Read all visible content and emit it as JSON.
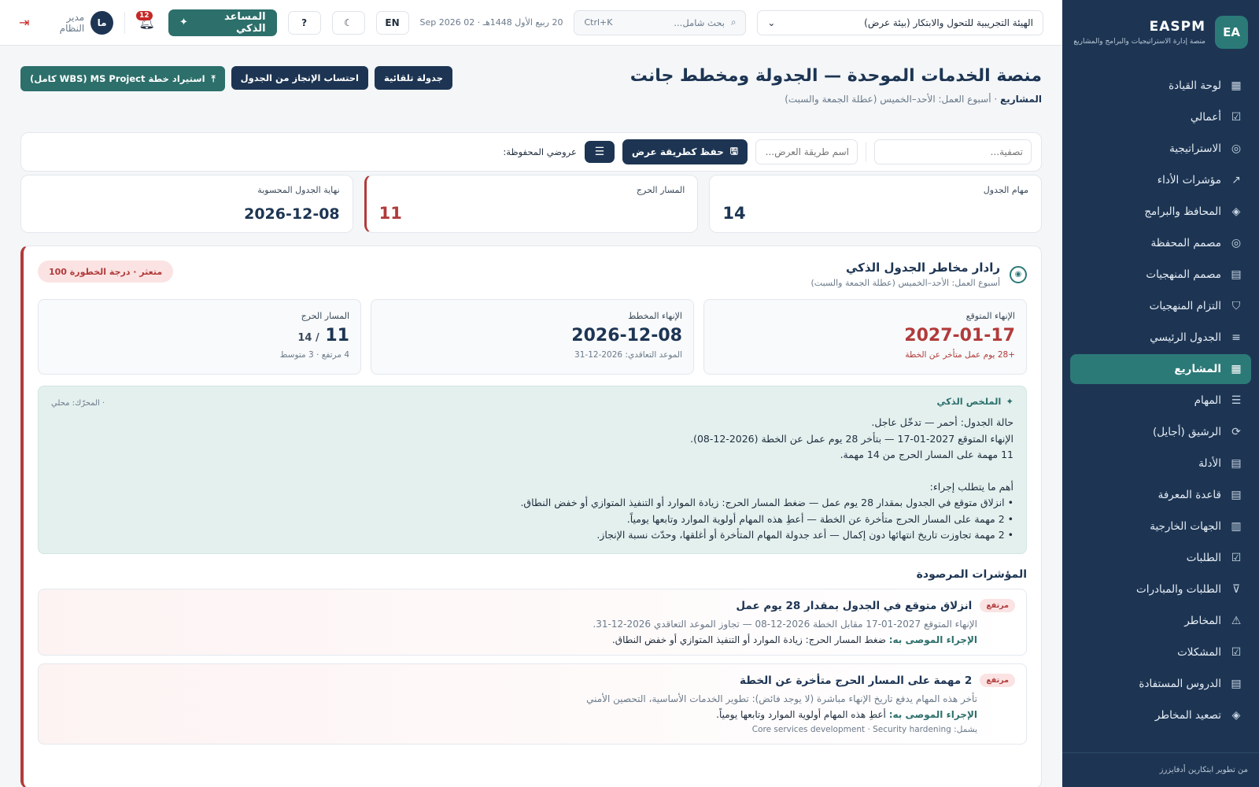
{
  "sidebar": {
    "brand_badge": "EA",
    "brand_title": "EASPM",
    "brand_sub": "منصة إدارة الاستراتيجيات والبرامج والمشاريع",
    "items": [
      {
        "label": "لوحة القيادة",
        "icon": "▦"
      },
      {
        "label": "أعمالي",
        "icon": "☑"
      },
      {
        "label": "الاستراتيجية",
        "icon": "◎"
      },
      {
        "label": "مؤشرات الأداء",
        "icon": "↗"
      },
      {
        "label": "المحافظ والبرامج",
        "icon": "◈"
      },
      {
        "label": "مصمم المحفظة",
        "icon": "◎"
      },
      {
        "label": "مصمم المنهجيات",
        "icon": "▤"
      },
      {
        "label": "التزام المنهجيات",
        "icon": "⛉"
      },
      {
        "label": "الجدول الرئيسي",
        "icon": "≡"
      },
      {
        "label": "المشاريع",
        "icon": "▦"
      },
      {
        "label": "المهام",
        "icon": "☰"
      },
      {
        "label": "الرشيق (أجايل)",
        "icon": "⟳"
      },
      {
        "label": "الأدلة",
        "icon": "▤"
      },
      {
        "label": "قاعدة المعرفة",
        "icon": "▤"
      },
      {
        "label": "الجهات الخارجية",
        "icon": "▥"
      },
      {
        "label": "الطلبات",
        "icon": "☑"
      },
      {
        "label": "الطلبات والمبادرات",
        "icon": "⊽"
      },
      {
        "label": "المخاطر",
        "icon": "⚠"
      },
      {
        "label": "المشكلات",
        "icon": "☑"
      },
      {
        "label": "الدروس المستفادة",
        "icon": "▤"
      },
      {
        "label": "تصعيد المخاطر",
        "icon": "◈"
      }
    ],
    "footer": "من تطوير ابتكارين أدفايزرز"
  },
  "topbar": {
    "org": "الهيئة التجريبية للتحول والابتكار (بيئة عرض)",
    "search_placeholder": "بحث شامل...",
    "search_shortcut": "Ctrl+K",
    "date": "20 ربيع الأول 1448هـ  ·  02 Sep 2026",
    "lang": "EN",
    "ai_label": "المساعد الذكي",
    "notifications": "12",
    "avatar": "ما",
    "user_name": "مدير النظام"
  },
  "page": {
    "title": "منصة الخدمات الموحدة — الجدولة ومخطط جانت",
    "breadcrumb": "المشاريع",
    "workweek": "أسبوع العمل: الأحد–الخميس (عطلة الجمعة والسبت)",
    "btn_auto": "جدولة تلقائية",
    "btn_calc": "احتساب الإنجاز من الجدول",
    "btn_import": "استيراد خطة MS Project (WBS كامل)"
  },
  "views": {
    "filter_placeholder": "تصفية...",
    "name_placeholder": "اسم طريقة العرض...",
    "save_label": "حفظ كطريقة عرض",
    "saved_label": "عروضي المحفوظة:"
  },
  "stats": {
    "tasks_label": "مهام الجدول",
    "tasks_value": "14",
    "critical_label": "المسار الحرج",
    "critical_value": "11",
    "end_label": "نهاية الجدول المحسوبة",
    "end_value": "2026-12-08"
  },
  "radar": {
    "title": "رادار مخاطر الجدول الذكي",
    "sub": "أسبوع العمل: الأحد–الخميس (عطلة الجمعة والسبت)",
    "risk": "متعثر · درجة الخطورة 100",
    "expected_label": "الإنهاء المتوقع",
    "expected_value": "2027-01-17",
    "expected_note": "+28 يوم عمل متأخر عن الخطة",
    "planned_label": "الإنهاء المخطط",
    "planned_value": "2026-12-08",
    "planned_note": "الموعد التعاقدي: 2026-12-31",
    "critical_label": "المسار الحرج",
    "critical_value": "11",
    "critical_total": "/ 14",
    "critical_note": "4 مرتفع · 3 متوسط",
    "summary_title": "الملخص الذكي",
    "summary_engine": "· المحرّك: محلي",
    "summary_lines": [
      "حالة الجدول: أحمر — تدخّل عاجل.",
      "الإنهاء المتوقع 2027-01-17 — بتأخر 28 يوم عمل عن الخطة (2026-12-08).",
      "11 مهمة على المسار الحرج من 14 مهمة."
    ],
    "actions_title": "أهم ما يتطلب إجراء:",
    "action_lines": [
      "• انزلاق متوقع في الجدول بمقدار 28 يوم عمل — ضغط المسار الحرج: زيادة الموارد أو التنفيذ المتوازي أو خفض النطاق.",
      "• 2 مهمة على المسار الحرج متأخرة عن الخطة — أعطِ هذه المهام أولوية الموارد وتابعها يومياً.",
      "• 2 مهمة تجاوزت تاريخ انتهائها دون إكمال — أعد جدولة المهام المتأخرة أو أغلقها، وحدّث نسبة الإنجاز."
    ],
    "monitored_title": "المؤشرات المرصودة",
    "alerts": [
      {
        "tag": "مرتفع",
        "title": "انزلاق متوقع في الجدول بمقدار 28 يوم عمل",
        "line": "الإنهاء المتوقع 2027-01-17 مقابل الخطة 2026-12-08 — تجاوز الموعد التعاقدي 2026-12-31.",
        "action_label": "الإجراء الموصى به:",
        "action": "ضغط المسار الحرج: زيادة الموارد أو التنفيذ المتوازي أو خفض النطاق.",
        "includes": ""
      },
      {
        "tag": "مرتفع",
        "title": "2 مهمة على المسار الحرج متأخرة عن الخطة",
        "line": "تأخر هذه المهام يدفع تاريخ الإنهاء مباشرة (لا يوجد فائض): تطوير الخدمات الأساسية، التحصين الأمني",
        "action_label": "الإجراء الموصى به:",
        "action": "أعطِ هذه المهام أولوية الموارد وتابعها يومياً.",
        "includes": "يشمل: Core services development · Security hardening"
      }
    ]
  }
}
